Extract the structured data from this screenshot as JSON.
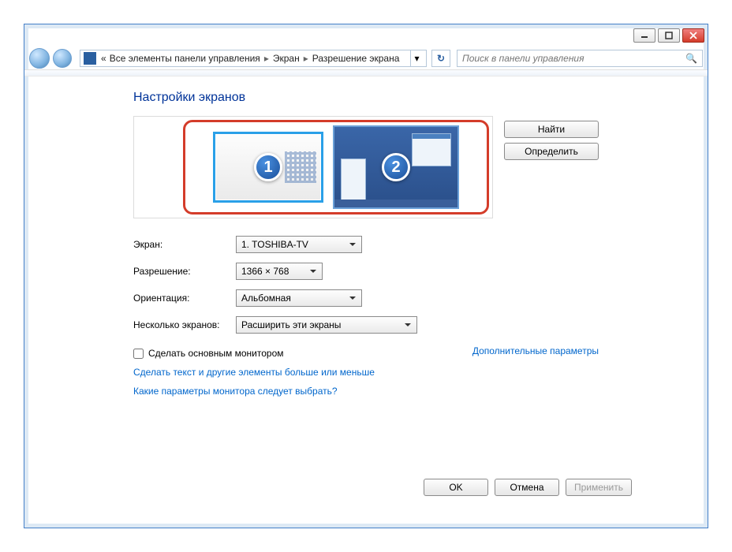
{
  "breadcrumb": {
    "root_sep": "«",
    "item1": "Все элементы панели управления",
    "item2": "Экран",
    "item3": "Разрешение экрана"
  },
  "search": {
    "placeholder": "Поиск в панели управления"
  },
  "title": "Настройки экранов",
  "monitors": {
    "num1": "1",
    "num2": "2"
  },
  "side": {
    "find": "Найти",
    "detect": "Определить"
  },
  "form": {
    "screen_label": "Экран:",
    "screen_value": "1. TOSHIBA-TV",
    "resolution_label": "Разрешение:",
    "resolution_value": "1366 × 768",
    "orientation_label": "Ориентация:",
    "orientation_value": "Альбомная",
    "multi_label": "Несколько экранов:",
    "multi_value": "Расширить эти экраны"
  },
  "checkbox": {
    "label": "Сделать основным монитором"
  },
  "links": {
    "advanced": "Дополнительные параметры",
    "textsize": "Сделать текст и другие элементы больше или меньше",
    "which": "Какие параметры монитора следует выбрать?"
  },
  "footer": {
    "ok": "OK",
    "cancel": "Отмена",
    "apply": "Применить"
  }
}
